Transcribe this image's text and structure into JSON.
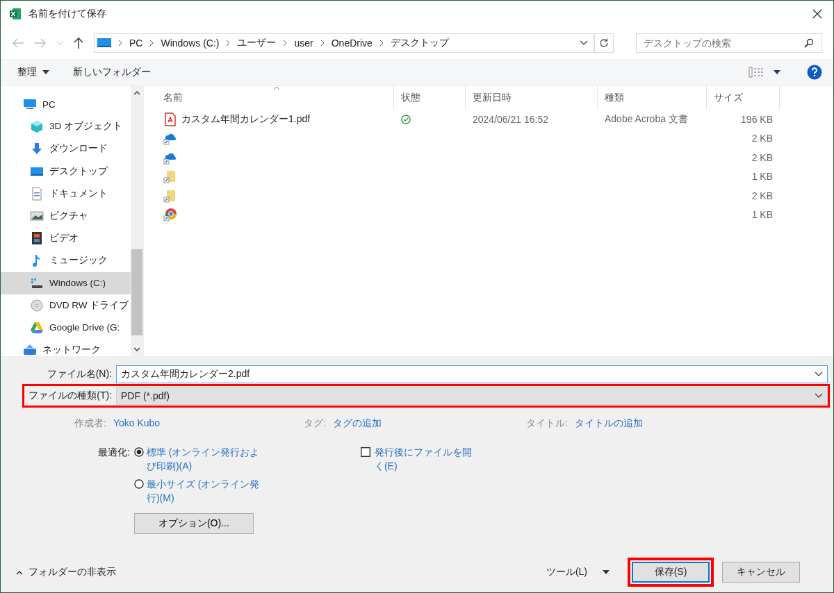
{
  "window": {
    "title": "名前を付けて保存"
  },
  "address": {
    "crumbs": [
      "PC",
      "Windows (C:)",
      "ユーザー",
      "user",
      "OneDrive",
      "デスクトップ"
    ],
    "search_placeholder": "デスクトップの検索"
  },
  "toolbar": {
    "organize": "整理",
    "new_folder": "新しいフォルダー"
  },
  "sidebar": {
    "items": [
      {
        "label": "PC",
        "kind": "pc",
        "selected": false,
        "children": [
          {
            "label": "3D オブジェクト",
            "kind": "cube",
            "selected": false
          },
          {
            "label": "ダウンロード",
            "kind": "download",
            "selected": false
          },
          {
            "label": "デスクトップ",
            "kind": "desktop",
            "selected": false
          },
          {
            "label": "ドキュメント",
            "kind": "document",
            "selected": false
          },
          {
            "label": "ピクチャ",
            "kind": "pictures",
            "selected": false
          },
          {
            "label": "ビデオ",
            "kind": "video",
            "selected": false
          },
          {
            "label": "ミュージック",
            "kind": "music",
            "selected": false
          },
          {
            "label": "Windows (C:)",
            "kind": "drive",
            "selected": true
          },
          {
            "label": "DVD RW ドライブ",
            "kind": "disc",
            "selected": false
          },
          {
            "label": "Google Drive (G:",
            "kind": "gdrive",
            "selected": false
          }
        ]
      },
      {
        "label": "ネットワーク",
        "kind": "network",
        "selected": false
      }
    ]
  },
  "table": {
    "columns": [
      "名前",
      "状態",
      "更新日時",
      "種類",
      "サイズ"
    ],
    "rows": [
      {
        "kind": "pdf",
        "name": "カスタム年間カレンダー1.pdf",
        "synced": true,
        "modified": "2024/06/21 16:52",
        "type": "Adobe Acroba 文書",
        "size": "196 KB"
      },
      {
        "kind": "cloud",
        "size": "2 KB"
      },
      {
        "kind": "cloud",
        "size": "2 KB"
      },
      {
        "kind": "folder",
        "size": "1 KB"
      },
      {
        "kind": "folder",
        "size": "2 KB"
      },
      {
        "kind": "chrome",
        "size": "1 KB"
      }
    ]
  },
  "form": {
    "filename_label": "ファイル名(N):",
    "filename": "カスタム年間カレンダー2.pdf",
    "filetype_label": "ファイルの種類(T):",
    "filetype": "PDF (*.pdf)",
    "filetype_highlighted": true,
    "meta": [
      {
        "label": "作成者:",
        "value": "Yoko Kubo"
      },
      {
        "label": "タグ:",
        "value": "タグの追加"
      },
      {
        "label": "タイトル:",
        "value": "タイトルの追加"
      }
    ],
    "optimize_label": "最適化:",
    "optimize_options": [
      {
        "label": "標準 (オンライン発行および印刷)(A)",
        "selected": true
      },
      {
        "label": "最小サイズ (オンライン発行)(M)",
        "selected": false
      }
    ],
    "open_after": {
      "label": "発行後にファイルを開く(E)",
      "checked": false
    },
    "options_button": "オプション(O)..."
  },
  "footer": {
    "hide_folders": "フォルダーの非表示",
    "tools": "ツール(L)",
    "save": "保存(S)",
    "save_highlighted": true,
    "cancel": "キャンセル"
  }
}
